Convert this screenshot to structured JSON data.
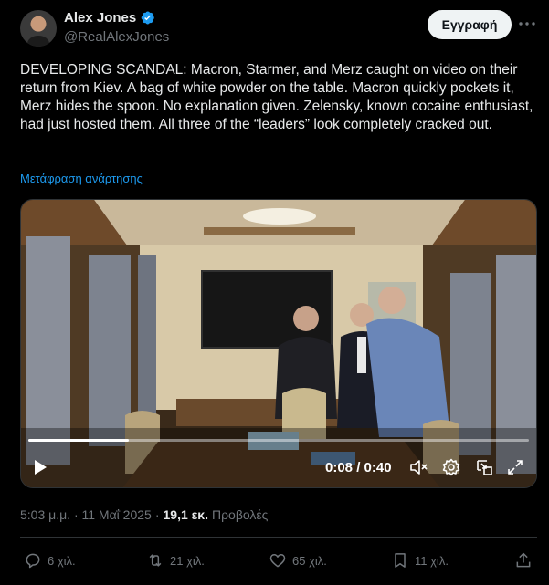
{
  "author": {
    "display_name": "Alex Jones",
    "handle": "@RealAlexJones",
    "verified_icon": "verified-badge-icon"
  },
  "header": {
    "subscribe_label": "Εγγραφή",
    "more_icon": "more-icon"
  },
  "post": {
    "text": "DEVELOPING SCANDAL: Macron, Starmer, and Merz caught on video on their return from Kiev. A bag of white powder on the table. Macron quickly pockets it, Merz hides the spoon. No explanation given. Zelensky, known cocaine enthusiast, had just hosted them. All three of the “leaders” look completely cracked out.",
    "translate_label": "Μετάφραση ανάρτησης"
  },
  "video": {
    "time_display": "0:08 / 0:40",
    "progress_fraction": 0.2,
    "controls": [
      "play-icon",
      "mute-icon",
      "settings-icon",
      "pip-icon",
      "fullscreen-icon"
    ]
  },
  "meta": {
    "timestamp": "5:03 μ.μ. · 11 Μαΐ 2025",
    "separator": "·",
    "views_count": "19,1 εκ.",
    "views_label": "Προβολές"
  },
  "actions": {
    "replies": "6 χιλ.",
    "reposts": "21 χιλ.",
    "likes": "65 χιλ.",
    "bookmarks": "11 χιλ."
  },
  "colors": {
    "background": "#000000",
    "text_primary": "#e7e9ea",
    "text_secondary": "#71767b",
    "link": "#1d9bf0",
    "verified": "#1d9bf0",
    "button_bg": "#eff3f4"
  }
}
